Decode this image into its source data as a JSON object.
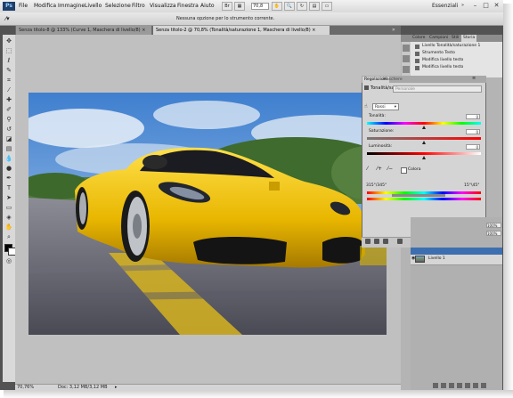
{
  "menubar": {
    "logo": "Ps",
    "items": [
      "File",
      "Modifica",
      "Immagine",
      "Livello",
      "Selezione",
      "Filtro",
      "Visualizza",
      "Finestra",
      "Aiuto"
    ],
    "zoom": "70,8",
    "workspace": "Essenziali",
    "minimize": "–",
    "maximize": "□",
    "close": "✕"
  },
  "options": {
    "message": "Nessuna opzione per lo strumento corrente."
  },
  "tabs": [
    {
      "label": "Senza titolo-8 @ 133% (Curve 1, Maschera di livello/8)",
      "close": "×"
    },
    {
      "label": "Senza titolo-2 @ 70,8% (Tonalità/saturazione 1, Maschera di livello/8)",
      "close": "×"
    }
  ],
  "status": {
    "zoom": "70,76%",
    "doc": "Doc: 3,12 MB/3,12 MB"
  },
  "right_tabs": [
    "Colore",
    "Campioni",
    "Stili",
    "Storia"
  ],
  "history": [
    "Livello Tonalità/saturazione 1",
    "Strumento Testo",
    "Modifica livello testo",
    "Modifica livello testo"
  ],
  "adjustments": {
    "tab_selected": "Regolazioni",
    "tab_other": "Maschere",
    "title": "Tonalità/sat.",
    "preset": "Personale",
    "edit_channel": "Rossi",
    "hue_label": "Tonalità:",
    "hue_value": "0",
    "sat_label": "Saturazione:",
    "sat_value": "0",
    "light_label": "Luminosità:",
    "light_value": "0",
    "colorize_label": "Colora",
    "range_left": "315°/345°",
    "range_right": "15°\\45°"
  },
  "layers": {
    "opacity": "100%",
    "fill": "100%",
    "layer_name": "Livello 1"
  }
}
